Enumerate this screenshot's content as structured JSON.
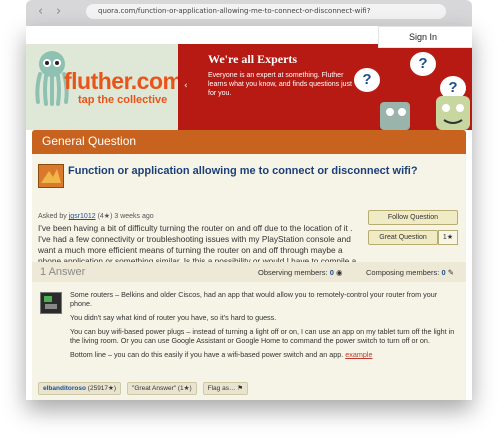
{
  "browser": {
    "back": "‹",
    "forward": "›",
    "url": "quora.com/function-or-application-allowing-me-to-connect-or-disconnect-wifi?"
  },
  "header": {
    "signin_label": "Sign In",
    "logo": "fluther.com",
    "tagline": "tap the collective",
    "banner_title": "We're all Experts",
    "banner_text": "Everyone is an expert at something. Fluther learns what you know, and finds questions just for you.",
    "banner_arrow": "‹",
    "bubble_mark": "?"
  },
  "section": {
    "title": "General Question"
  },
  "question": {
    "title": "Function or application allowing me to connect or disconnect wifi?",
    "asked_prefix": "Asked by",
    "asker": "jgsr1012",
    "asker_score": "(4",
    "asker_score_suffix": ")",
    "asked_time": "3 weeks ago",
    "body": "I've been having a bit of difficulty turning the router on and off due to the location of it . I've had a few connectivity or troubleshooting issues with my PlayStation console and want a much more efficient means of turning the router on and off through maybe a phone application or something similar. Is this a possibility or would I have to compile a program myself? Thank you for your responses.",
    "follow_label": "Follow Question",
    "great_label": "Great Question",
    "great_count": "1"
  },
  "answers": {
    "title": "1 Answer",
    "observing_label": "Observing members:",
    "observing_count": "0",
    "composing_label": "Composing members:",
    "composing_count": "0",
    "items": [
      {
        "p1": "Some routers – Belkins and older Ciscos, had an app that would allow you to remotely-control your router from your phone.",
        "p2": "You didn't say what kind of router you have, so it's hard to guess.",
        "p3": "You can buy wifi-based power plugs – instead of turning a light off or on, I can use an app on my tablet turn off the light in the living room. Or you can use Google Assistant or Google Home to command the power switch to turn off or on.",
        "p4": "Bottom line – you can do this easily if you have a wifi-based power switch and an app.",
        "link": "example",
        "author": "elbanditoroso",
        "author_score": "(25917",
        "author_score_suffix": ")",
        "great_answer": "\"Great Answer\" (1",
        "great_answer_suffix": ")",
        "flag": "Flag as…"
      }
    ]
  },
  "colors": {
    "brand_orange": "#e8541a",
    "banner_red": "#b71a13",
    "section_bar": "#c8631f",
    "link_blue": "#1c3f7a"
  }
}
